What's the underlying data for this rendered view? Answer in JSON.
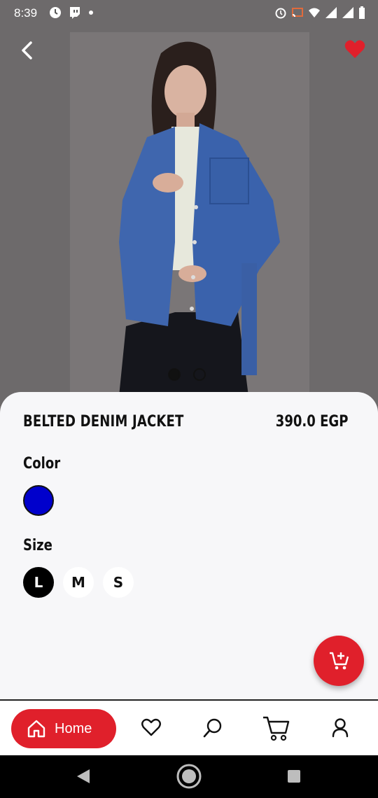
{
  "status_bar": {
    "time": "8:39",
    "icons": [
      "clock-icon",
      "twitch-icon",
      "dot-icon",
      "alarm-icon",
      "cast-icon",
      "wifi-icon",
      "signal-icon",
      "signal-icon",
      "battery-icon"
    ]
  },
  "product": {
    "name": "BELTED DENIM JACKET",
    "price": "390.0 EGP",
    "favorite": true,
    "image_count": 2,
    "active_image": 0
  },
  "color": {
    "label": "Color",
    "options": [
      {
        "hex": "#0000cc",
        "selected": true
      }
    ]
  },
  "size": {
    "label": "Size",
    "options": [
      {
        "label": "L",
        "selected": true
      },
      {
        "label": "M",
        "selected": false
      },
      {
        "label": "S",
        "selected": false
      }
    ]
  },
  "bottom_nav": {
    "home_label": "Home",
    "items": [
      "home-icon",
      "heart-icon",
      "search-icon",
      "cart-icon",
      "user-icon"
    ]
  },
  "colors": {
    "accent": "#e0202b",
    "sheet_bg": "#f7f7f9",
    "swatch": "#0000cc"
  }
}
